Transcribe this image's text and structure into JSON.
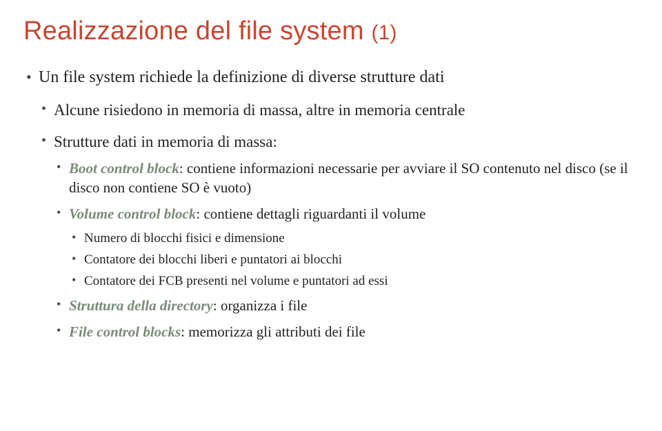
{
  "title_main": "Realizzazione del file system",
  "title_suffix": "(1)",
  "bullets": {
    "b1": "Un file system richiede la definizione di diverse strutture dati",
    "b1_1": "Alcune risiedono in memoria di massa, altre in memoria centrale",
    "b1_2": "Strutture dati in memoria di massa:",
    "b1_2_1_term": "Boot control block",
    "b1_2_1_rest": ": contiene informazioni necessarie per avviare il SO contenuto nel disco (se il disco non contiene SO è vuoto)",
    "b1_2_2_term": "Volume control block",
    "b1_2_2_rest": ": contiene dettagli riguardanti il volume",
    "b1_2_2_a": "Numero di blocchi fisici e dimensione",
    "b1_2_2_b": "Contatore dei blocchi liberi e puntatori ai blocchi",
    "b1_2_2_c": "Contatore dei FCB presenti nel volume e puntatori ad essi",
    "b1_2_3_term": "Struttura della directory",
    "b1_2_3_rest": ": organizza i file",
    "b1_2_4_term": "File control blocks",
    "b1_2_4_rest": ": memorizza gli attributi dei file"
  }
}
